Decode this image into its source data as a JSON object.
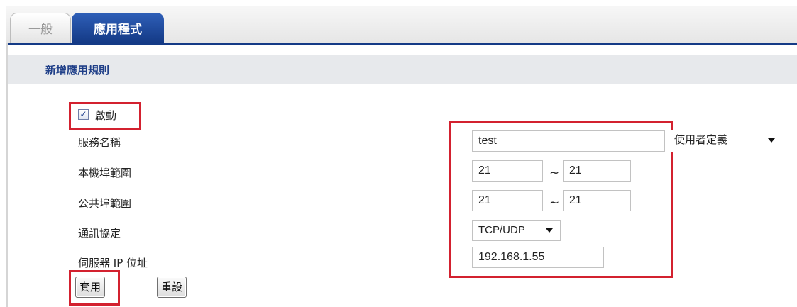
{
  "tabs": {
    "general_label": "一般",
    "apps_label": "應用程式",
    "selected": "應用程式"
  },
  "section": {
    "title": "新增應用規則"
  },
  "form": {
    "enable": {
      "label": "啟動",
      "checked": true
    },
    "service_name": {
      "label": "服務名稱",
      "value": "test",
      "type_option": "使用者定義"
    },
    "local_port_range": {
      "label": "本機埠範圍",
      "from": "21",
      "separator": "~",
      "to": "21"
    },
    "public_port_range": {
      "label": "公共埠範圍",
      "from": "21",
      "separator": "~",
      "to": "21"
    },
    "protocol": {
      "label": "通訊協定",
      "value": "TCP/UDP"
    },
    "server_ip": {
      "label": "伺服器 IP 位址",
      "value": "192.168.1.55"
    }
  },
  "buttons": {
    "apply_label": "套用",
    "reset_label": "重設"
  },
  "highlight_color": "#d3212f",
  "accent_color": "#143a86"
}
